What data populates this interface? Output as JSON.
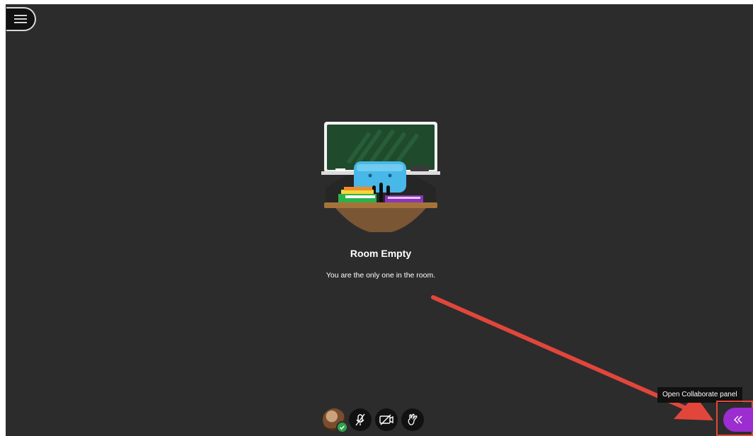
{
  "room": {
    "title": "Room Empty",
    "message": "You are the only one in the room."
  },
  "menu": {
    "icon": "hamburger-menu-icon"
  },
  "controls": {
    "avatar": "user-avatar",
    "status_icon": "checkmark-icon",
    "microphone_icon": "microphone-muted-icon",
    "camera_icon": "camera-off-icon",
    "hand_icon": "raise-hand-icon"
  },
  "panel": {
    "tooltip": "Open Collaborate panel",
    "icon": "double-chevron-left-icon"
  },
  "colors": {
    "background": "#2c2c2c",
    "accent": "#9b2dd1",
    "highlight": "#e2463b",
    "status_ok": "#2fa24a"
  }
}
